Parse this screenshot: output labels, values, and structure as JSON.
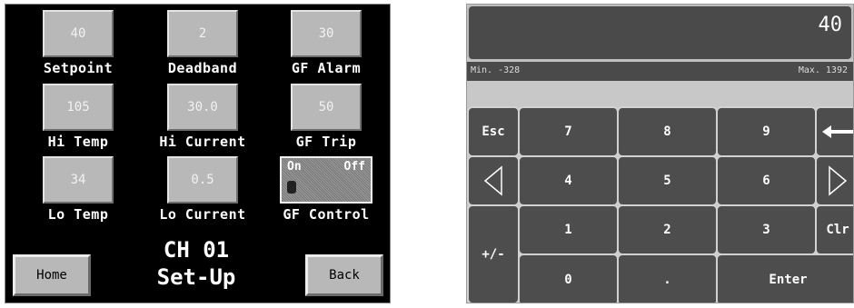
{
  "setup_screen": {
    "fields": [
      {
        "value": "40",
        "label": "Setpoint"
      },
      {
        "value": "2",
        "label": "Deadband"
      },
      {
        "value": "30",
        "label": "GF Alarm"
      },
      {
        "value": "105",
        "label": "Hi Temp"
      },
      {
        "value": "30.0",
        "label": "Hi Current"
      },
      {
        "value": "50",
        "label": "GF Trip"
      },
      {
        "value": "34",
        "label": "Lo Temp"
      },
      {
        "value": "0.5",
        "label": "Lo Current"
      }
    ],
    "gf_control": {
      "on_label": "On",
      "off_label": "Off",
      "label": "GF Control"
    },
    "title_line1": "CH 01",
    "title_line2": "Set-Up",
    "home_label": "Home",
    "back_label": "Back"
  },
  "keypad": {
    "display_value": "40",
    "min_text": "Min. -328",
    "max_text": "Max. 1392",
    "keys": {
      "esc": "Esc",
      "k7": "7",
      "k8": "8",
      "k9": "9",
      "k4": "4",
      "k5": "5",
      "k6": "6",
      "k1": "1",
      "k2": "2",
      "k3": "3",
      "k0": "0",
      "dot": ".",
      "plus_minus": "+/-",
      "clr": "Clr",
      "enter": "Enter"
    },
    "icons": {
      "backspace": "arrow-left-icon",
      "left": "triangle-left-icon",
      "right": "triangle-right-icon"
    }
  }
}
